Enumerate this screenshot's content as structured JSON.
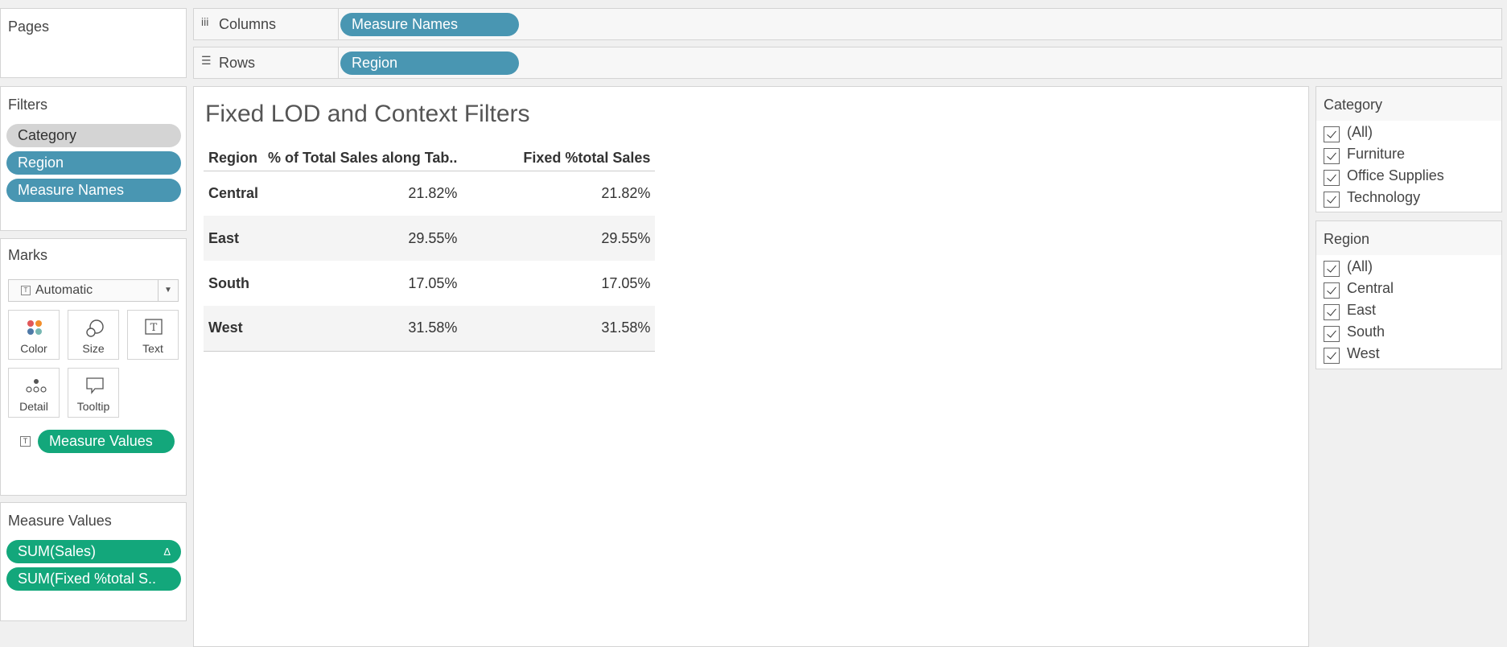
{
  "pages": {
    "title": "Pages"
  },
  "columns_shelf": {
    "label": "Columns",
    "pills": [
      "Measure Names"
    ]
  },
  "rows_shelf": {
    "label": "Rows",
    "pills": [
      "Region"
    ]
  },
  "filters": {
    "title": "Filters",
    "pills": [
      "Category",
      "Region",
      "Measure Names"
    ]
  },
  "marks": {
    "title": "Marks",
    "mark_type": "Automatic",
    "buttons": [
      "Color",
      "Size",
      "Text",
      "Detail",
      "Tooltip"
    ],
    "text_pill": "Measure Values"
  },
  "measure_values": {
    "title": "Measure Values",
    "pills": [
      "SUM(Sales)",
      "SUM(Fixed %total  S.."
    ],
    "delta_icon": "Δ"
  },
  "view": {
    "title": "Fixed LOD and Context Filters",
    "headers": [
      "Region",
      "% of Total Sales along Tab..",
      "Fixed %total  Sales"
    ],
    "rows": [
      {
        "region": "Central",
        "pct_total": "21.82%",
        "fixed_pct": "21.82%"
      },
      {
        "region": "East",
        "pct_total": "29.55%",
        "fixed_pct": "29.55%"
      },
      {
        "region": "South",
        "pct_total": "17.05%",
        "fixed_pct": "17.05%"
      },
      {
        "region": "West",
        "pct_total": "31.58%",
        "fixed_pct": "31.58%"
      }
    ]
  },
  "category_filter": {
    "title": "Category",
    "items": [
      "(All)",
      "Furniture",
      "Office Supplies",
      "Technology"
    ]
  },
  "region_filter": {
    "title": "Region",
    "items": [
      "(All)",
      "Central",
      "East",
      "South",
      "West"
    ]
  },
  "colors": {
    "dimension_pill": "#4996b2",
    "measure_pill": "#13a77b",
    "context_pill": "#d4d4d4"
  }
}
